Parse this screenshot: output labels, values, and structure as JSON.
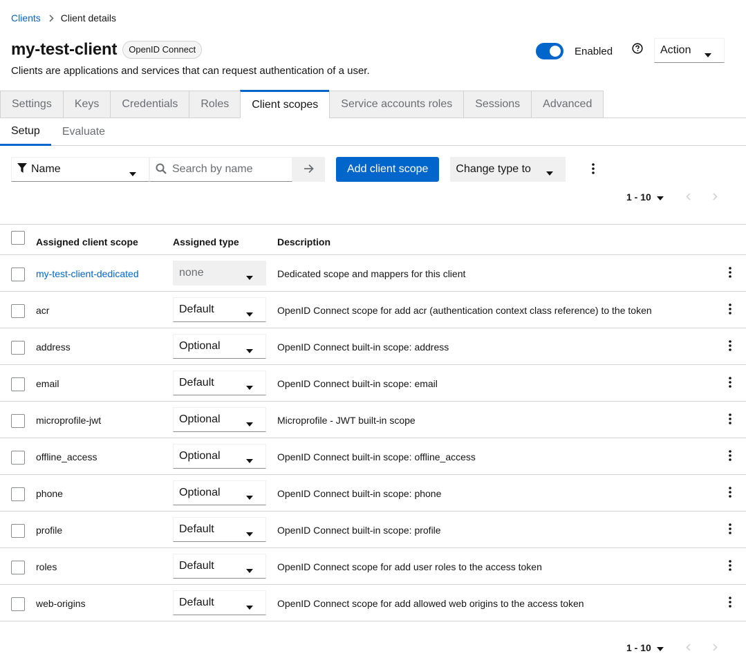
{
  "breadcrumb": {
    "parent": "Clients",
    "current": "Client details"
  },
  "header": {
    "title": "my-test-client",
    "badge": "OpenID Connect",
    "subtitle": "Clients are applications and services that can request authentication of a user.",
    "enabled_label": "Enabled",
    "enabled": true,
    "action_label": "Action"
  },
  "tabs": [
    {
      "label": "Settings"
    },
    {
      "label": "Keys"
    },
    {
      "label": "Credentials"
    },
    {
      "label": "Roles"
    },
    {
      "label": "Client scopes",
      "active": true
    },
    {
      "label": "Service accounts roles"
    },
    {
      "label": "Sessions"
    },
    {
      "label": "Advanced"
    }
  ],
  "subtabs": [
    {
      "label": "Setup",
      "active": true
    },
    {
      "label": "Evaluate"
    }
  ],
  "toolbar": {
    "filter_label": "Name",
    "search_placeholder": "Search by name",
    "add_button": "Add client scope",
    "change_type": "Change type to"
  },
  "pagination": {
    "range": "1 - 10"
  },
  "table": {
    "headers": {
      "name": "Assigned client scope",
      "type": "Assigned type",
      "desc": "Description"
    },
    "rows": [
      {
        "name": "my-test-client-dedicated",
        "type": "none",
        "desc": "Dedicated scope and mappers for this client",
        "link": true,
        "disabled": true
      },
      {
        "name": "acr",
        "type": "Default",
        "desc": "OpenID Connect scope for add acr (authentication context class reference) to the token"
      },
      {
        "name": "address",
        "type": "Optional",
        "desc": "OpenID Connect built-in scope: address"
      },
      {
        "name": "email",
        "type": "Default",
        "desc": "OpenID Connect built-in scope: email"
      },
      {
        "name": "microprofile-jwt",
        "type": "Optional",
        "desc": "Microprofile - JWT built-in scope"
      },
      {
        "name": "offline_access",
        "type": "Optional",
        "desc": "OpenID Connect built-in scope: offline_access"
      },
      {
        "name": "phone",
        "type": "Optional",
        "desc": "OpenID Connect built-in scope: phone"
      },
      {
        "name": "profile",
        "type": "Default",
        "desc": "OpenID Connect built-in scope: profile"
      },
      {
        "name": "roles",
        "type": "Default",
        "desc": "OpenID Connect scope for add user roles to the access token"
      },
      {
        "name": "web-origins",
        "type": "Default",
        "desc": "OpenID Connect scope for add allowed web origins to the access token"
      }
    ]
  },
  "colors": {
    "accent": "#0066cc",
    "border": "#d2d2d2",
    "muted": "#6a6e73"
  }
}
